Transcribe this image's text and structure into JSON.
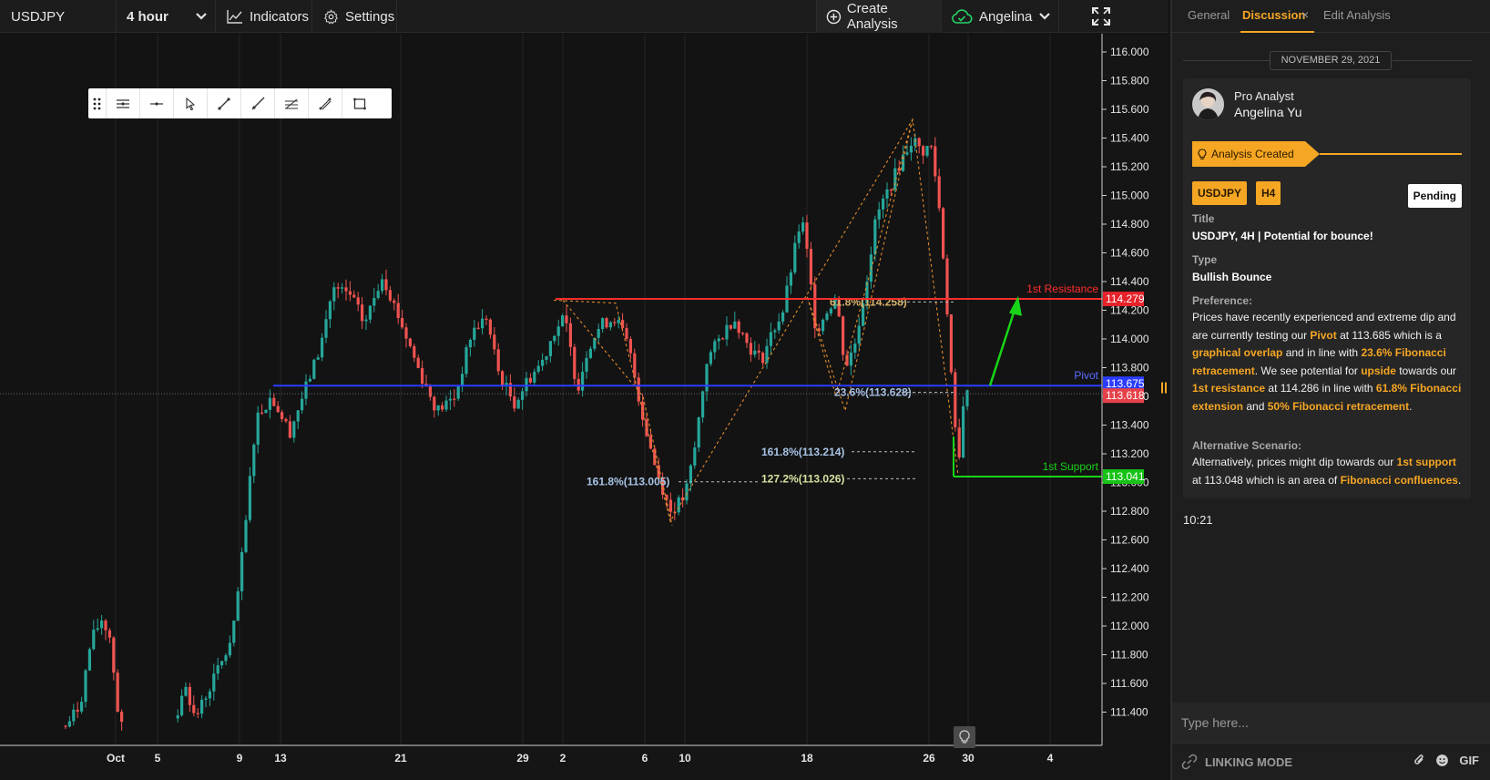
{
  "toolbar": {
    "symbol": "USDJPY",
    "interval": "4 hour",
    "indicators_label": "Indicators",
    "settings_label": "Settings",
    "create_label": "Create Analysis",
    "user_label": "Angelina"
  },
  "chart": {
    "y_ticks": [
      "116.000",
      "115.800",
      "115.600",
      "115.400",
      "115.200",
      "115.000",
      "114.800",
      "114.600",
      "114.400",
      "114.200",
      "114.000",
      "113.800",
      "113.600",
      "113.400",
      "113.200",
      "113.000",
      "112.800",
      "112.600",
      "112.400",
      "112.200",
      "112.000",
      "111.800",
      "111.600",
      "111.400"
    ],
    "x_ticks": [
      "Oct",
      "5",
      "9",
      "13",
      "21",
      "29",
      "2",
      "6",
      "10",
      "18",
      "26",
      "30",
      "4"
    ],
    "lines": {
      "resistance_label": "1st Resistance",
      "resistance_price": "114.279",
      "pivot_label": "Pivot",
      "pivot_price": "113.675",
      "current_price": "113.618",
      "support_label": "1st Support",
      "support_price": "113.041"
    },
    "fib_labels": {
      "fib_618_top": "61.8%(114.258)",
      "fib_236": "23.6%(113.628)",
      "fib_1618_a": "161.8%(113.214)",
      "fib_1272": "127.2%(113.026)",
      "fib_1618_b": "161.8%(113.005)"
    },
    "colors": {
      "up": "#26a69a",
      "down": "#ef5350",
      "resistance": "#ff2d2d",
      "pivot": "#2a3cff",
      "support": "#18d418",
      "fib": "#e08a2c"
    }
  },
  "drawing_tools": [
    "drag-handle-icon",
    "horizontal-lines-icon",
    "horizontal-line-icon",
    "cursor-icon",
    "trend-line-icon",
    "ray-icon",
    "parallel-channel-icon",
    "fib-icon",
    "rectangle-icon"
  ],
  "panel": {
    "tabs": {
      "general": "General",
      "discussion": "Discussion",
      "close": "×",
      "edit": "Edit Analysis"
    },
    "date": "NOVEMBER 29, 2021",
    "role": "Pro Analyst",
    "name": "Angelina Yu",
    "status": "Analysis Created",
    "badge_symbol": "USDJPY",
    "badge_timeframe": "H4",
    "pending": "Pending",
    "title_label": "Title",
    "title_value": "USDJPY, 4H | Potential for bounce!",
    "type_label": "Type",
    "type_value": "Bullish Bounce",
    "preference_label": "Preference:",
    "pref": {
      "t1": "Prices have recently experienced and extreme dip and are currently testing our ",
      "h1": "Pivot",
      "t2": " at 113.685 which is a ",
      "h2": "graphical overlap",
      "t3": " and in line with ",
      "h3": "23.6% Fibonacci retracement",
      "t4": ". We see potential for ",
      "h4": "upside",
      "t5": " towards our ",
      "h5": "1st resistance",
      "t6": " at 114.286 in line with ",
      "h6": "61.8% Fibonacci extension",
      "t7": " and ",
      "h7": "50% Fibonacci retracement",
      "t8": "."
    },
    "alt_label": "Alternative Scenario:",
    "alt": {
      "t1": "Alternatively, prices might dip towards our ",
      "h1": "1st support",
      "t2": " at 113.048 which is an area of ",
      "h2": "Fibonacci confluences",
      "t3": "."
    },
    "time": "10:21",
    "input_placeholder": "Type here...",
    "linking_mode": "LINKING MODE",
    "gif_label": "GIF"
  }
}
